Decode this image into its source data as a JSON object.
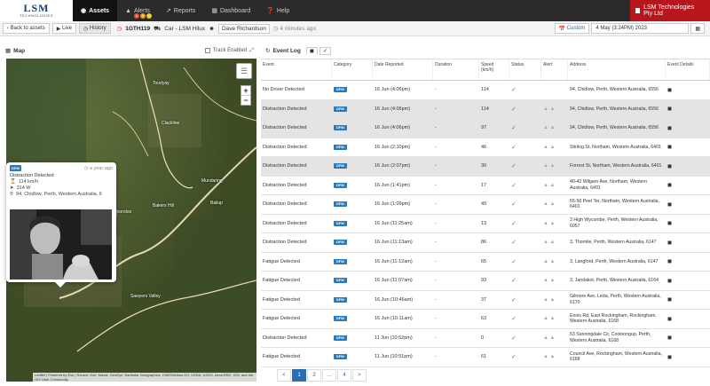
{
  "brand": {
    "logo_top": "LSM",
    "logo_bottom": "TECHNOLOGIES"
  },
  "nav": [
    {
      "label": "Assets",
      "icon": "car-icon",
      "active": true
    },
    {
      "label": "Alerts",
      "icon": "bell-icon",
      "active": false
    },
    {
      "label": "Reports",
      "icon": "chart-icon",
      "active": false
    },
    {
      "label": "Dashboard",
      "icon": "dashboard-icon",
      "active": false
    },
    {
      "label": "Help",
      "icon": "help-icon",
      "active": false
    }
  ],
  "company": "LSM Technologies Pty Ltd",
  "toolbar": {
    "back": "Back to assets",
    "live": "Live",
    "history": "History",
    "asset_id": "1GTH119",
    "asset_name": "Car - LSM Hilux",
    "driver": "Dave Richardson",
    "updated": "4 minutes ago",
    "custom": "Custom",
    "date": "4 May (3:24PM) 2023"
  },
  "map": {
    "title": "Map",
    "track_label": "Track Enabled",
    "attribution": "Leaflet | Powered by Esri | Source: Esri, Maxar, GeoEye, Earthstar Geographics, CNES/Airbus DS, USDA, USGS, AeroGRID, IGN, and the GIS User Community",
    "towns": [
      "Toodyay",
      "Clackline",
      "Mundaring",
      "Bailup",
      "Bakers Hill",
      "Wooroloo",
      "Sawyers Valley"
    ]
  },
  "popup": {
    "badge": "DFM",
    "time": "a year ago",
    "event": "Distraction Detected",
    "speed": "114 km/h",
    "heading": "314 W",
    "address": "94, Chidlow, Perth, Western Australia, 6"
  },
  "log": {
    "title": "Event Log",
    "columns": [
      "Event",
      "Category",
      "Date Reported",
      "Duration",
      "Speed (km/h)",
      "Status",
      "Alert",
      "Address",
      "Event Details"
    ],
    "rows": [
      {
        "event": "No Driver Detected",
        "date": "16 Jun (4:06pm)",
        "dur": "-",
        "speed": "114",
        "addr": "94, Chidlow, Perth, Western Australia, 6556",
        "sel": false
      },
      {
        "event": "Distraction Detected",
        "date": "16 Jun (4:06pm)",
        "dur": "-",
        "speed": "114",
        "addr": "94, Chidlow, Perth, Western Australia, 6556",
        "sel": true
      },
      {
        "event": "Distraction Detected",
        "date": "16 Jun (4:06pm)",
        "dur": "-",
        "speed": "97",
        "addr": "94, Chidlow, Perth, Western Australia, 6556",
        "sel": true
      },
      {
        "event": "Distraction Detected",
        "date": "16 Jun (2:10pm)",
        "dur": "-",
        "speed": "46",
        "addr": "Stirling St, Northam, Western Australia, 6401",
        "sel": false
      },
      {
        "event": "Distraction Detected",
        "date": "16 Jun (2:07pm)",
        "dur": "-",
        "speed": "30",
        "addr": "Forrest St, Northam, Western Australia, 6401",
        "sel": true
      },
      {
        "event": "Distraction Detected",
        "date": "16 Jun (1:41pm)",
        "dur": "-",
        "speed": "17",
        "addr": "40-42 Wilgarn Ave, Northam, Western Australia, 6401",
        "sel": false
      },
      {
        "event": "Distraction Detected",
        "date": "16 Jun (1:09pm)",
        "dur": "-",
        "speed": "49",
        "addr": "55-56 Peel Ter, Northam, Western Australia, 6401",
        "sel": false
      },
      {
        "event": "Distraction Detected",
        "date": "16 Jun (11:25am)",
        "dur": "-",
        "speed": "13",
        "addr": "3 High Wycombe, Perth, Western Australia, 6057",
        "sel": false
      },
      {
        "event": "Distraction Detected",
        "date": "16 Jun (11:13am)",
        "dur": "-",
        "speed": "86",
        "addr": "3, Thornlie, Perth, Western Australia, 6147",
        "sel": false
      },
      {
        "event": "Fatigue Detected",
        "date": "16 Jun (11:12am)",
        "dur": "-",
        "speed": "65",
        "addr": "3, Langford, Perth, Western Australia, 6147",
        "sel": false
      },
      {
        "event": "Fatigue Detected",
        "date": "16 Jun (11:07am)",
        "dur": "-",
        "speed": "93",
        "addr": "3, Jandakot, Perth, Western Australia, 6164",
        "sel": false
      },
      {
        "event": "Fatigue Detected",
        "date": "16 Jun (10:46am)",
        "dur": "-",
        "speed": "37",
        "addr": "Gilmore Ave, Leda, Perth, Western Australia, 6170",
        "sel": false
      },
      {
        "event": "Fatigue Detected",
        "date": "16 Jun (10:11am)",
        "dur": "-",
        "speed": "63",
        "addr": "Ennis Rd, East Rockingham, Rockingham, Western Australia, 6168",
        "sel": false
      },
      {
        "event": "Distraction Detected",
        "date": "11 Jun (10:52pm)",
        "dur": "-",
        "speed": "0",
        "addr": "53 Sunningdale Cir, Cooloongup, Perth, Western Australia, 6168",
        "sel": false
      },
      {
        "event": "Fatigue Detected",
        "date": "11 Jun (10:51pm)",
        "dur": "-",
        "speed": "61",
        "addr": "Council Ave, Rockingham, Western Australia, 6168",
        "sel": false
      }
    ],
    "category": "DFM",
    "status_icon": "check-icon"
  },
  "pager": [
    "<",
    "1",
    "2",
    "...",
    "4",
    ">"
  ],
  "pager_active": "1",
  "colors": {
    "nav_bg": "#2b2b2b",
    "company_bg": "#b7161d",
    "dfm_badge": "#2e7ab8",
    "status_ok": "#3a9a3a"
  }
}
